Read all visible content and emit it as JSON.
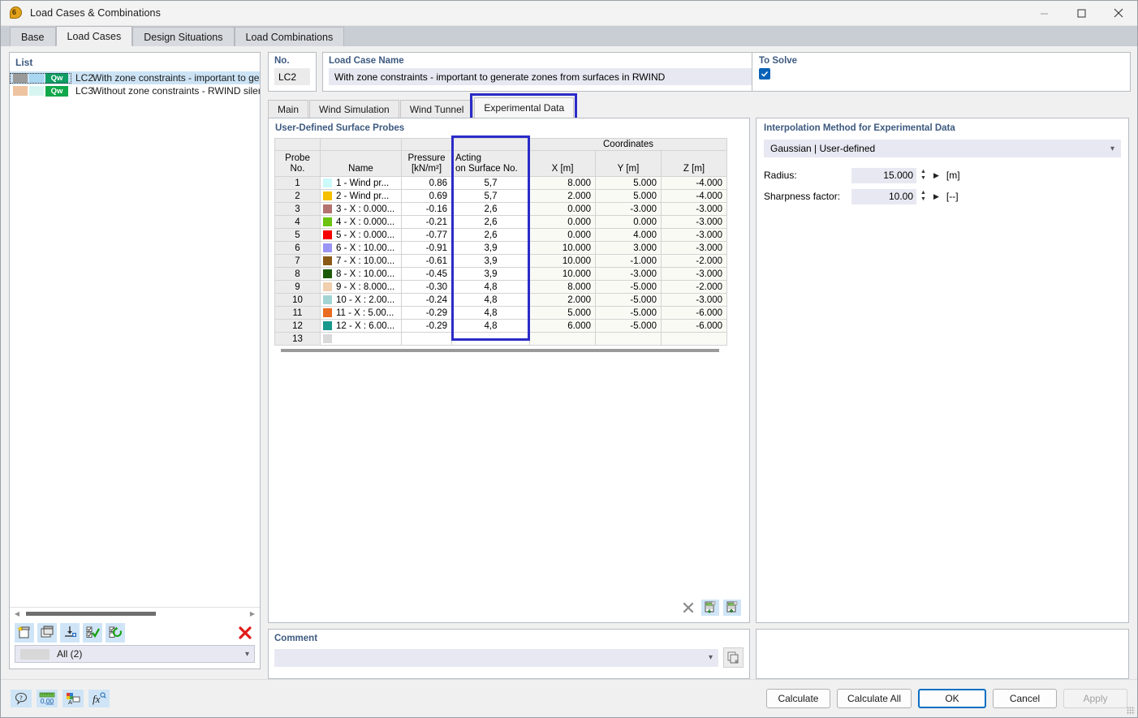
{
  "window": {
    "title": "Load Cases & Combinations",
    "icon": "load-case-icon",
    "minimize": "—",
    "maximize": "□",
    "close": "✕"
  },
  "top_tabs": [
    {
      "label": "Base",
      "active": false
    },
    {
      "label": "Load Cases",
      "active": true
    },
    {
      "label": "Design Situations",
      "active": false
    },
    {
      "label": "Load Combinations",
      "active": false
    }
  ],
  "list_panel": {
    "title": "List",
    "items": [
      {
        "no": "LC2",
        "name": "With zone constraints - important to generate zones from surfaces in RWIND",
        "badge": "Qw",
        "badge_color": "#0f9e63",
        "swatch1": "#9a9a9a",
        "swatch2": "#a9d6f0",
        "selected": true
      },
      {
        "no": "LC3",
        "name": "Without zone constraints - RWIND silent",
        "badge": "Qw",
        "badge_color": "#11a84a",
        "swatch1": "#edc3a0",
        "swatch2": "#d7f5f0",
        "selected": false
      }
    ],
    "toolbar": [
      {
        "name": "new-load-case-button",
        "icon": "new-window-icon"
      },
      {
        "name": "copy-load-case-button",
        "icon": "copy-window-icon"
      },
      {
        "name": "import-load-case-button",
        "icon": "import-icon"
      },
      {
        "name": "select-all-button",
        "icon": "checklist-check-icon"
      },
      {
        "name": "refresh-selection-button",
        "icon": "checklist-refresh-icon"
      },
      {
        "name": "delete-load-case-button",
        "icon": "red-x-icon"
      }
    ],
    "filter": {
      "label": "All (2)",
      "swatch": "#d8d8d8"
    }
  },
  "fields": {
    "no_label": "No.",
    "no_value": "LC2",
    "name_label": "Load Case Name",
    "name_value": "With zone constraints - important to generate zones from surfaces in RWIND"
  },
  "to_solve": {
    "label": "To Solve",
    "checked": true,
    "accent": "#0a62b8"
  },
  "inner_tabs": [
    {
      "label": "Main",
      "active": false
    },
    {
      "label": "Wind Simulation",
      "active": false
    },
    {
      "label": "Wind Tunnel",
      "active": false
    },
    {
      "label": "Experimental Data",
      "active": true,
      "highlighted": true
    }
  ],
  "probes": {
    "title": "User-Defined Surface Probes",
    "columns": {
      "probe_no": "Probe\nNo.",
      "probe_no_l1": "Probe",
      "probe_no_l2": "No.",
      "name": "Name",
      "pressure_l1": "Pressure",
      "pressure_l2": "[kN/m²]",
      "acting_l1": "Acting",
      "acting_l2": "on Surface No.",
      "coordinates": "Coordinates",
      "x": "X [m]",
      "y": "Y [m]",
      "z": "Z [m]"
    },
    "highlight_color": "#2b2bc8",
    "rows": [
      {
        "no": "1",
        "color": "#ccfafa",
        "name": "1 - Wind pr...",
        "pressure": "0.86",
        "surface": "5,7",
        "x": "8.000",
        "y": "5.000",
        "z": "-4.000"
      },
      {
        "no": "2",
        "color": "#f5c000",
        "name": "2 - Wind pr...",
        "pressure": "0.69",
        "surface": "5,7",
        "x": "2.000",
        "y": "5.000",
        "z": "-4.000"
      },
      {
        "no": "3",
        "color": "#b5736f",
        "name": "3 - X : 0.000...",
        "pressure": "-0.16",
        "surface": "2,6",
        "x": "0.000",
        "y": "-3.000",
        "z": "-3.000"
      },
      {
        "no": "4",
        "color": "#6cc310",
        "name": "4 - X : 0.000...",
        "pressure": "-0.21",
        "surface": "2,6",
        "x": "0.000",
        "y": "0.000",
        "z": "-3.000"
      },
      {
        "no": "5",
        "color": "#f60000",
        "name": "5 - X : 0.000...",
        "pressure": "-0.77",
        "surface": "2,6",
        "x": "0.000",
        "y": "4.000",
        "z": "-3.000"
      },
      {
        "no": "6",
        "color": "#9a95f5",
        "name": "6 - X : 10.00...",
        "pressure": "-0.91",
        "surface": "3,9",
        "x": "10.000",
        "y": "3.000",
        "z": "-3.000"
      },
      {
        "no": "7",
        "color": "#8a5a17",
        "name": "7 - X : 10.00...",
        "pressure": "-0.61",
        "surface": "3,9",
        "x": "10.000",
        "y": "-1.000",
        "z": "-2.000"
      },
      {
        "no": "8",
        "color": "#1d5a08",
        "name": "8 - X : 10.00...",
        "pressure": "-0.45",
        "surface": "3,9",
        "x": "10.000",
        "y": "-3.000",
        "z": "-3.000"
      },
      {
        "no": "9",
        "color": "#f0cfae",
        "name": "9 - X : 8.000...",
        "pressure": "-0.30",
        "surface": "4,8",
        "x": "8.000",
        "y": "-5.000",
        "z": "-2.000"
      },
      {
        "no": "10",
        "color": "#a3d4d4",
        "name": "10 - X : 2.00...",
        "pressure": "-0.24",
        "surface": "4,8",
        "x": "2.000",
        "y": "-5.000",
        "z": "-3.000"
      },
      {
        "no": "11",
        "color": "#ea6b22",
        "name": "11 - X : 5.00...",
        "pressure": "-0.29",
        "surface": "4,8",
        "x": "5.000",
        "y": "-5.000",
        "z": "-6.000"
      },
      {
        "no": "12",
        "color": "#17998c",
        "name": "12 - X : 6.00...",
        "pressure": "-0.29",
        "surface": "4,8",
        "x": "6.000",
        "y": "-5.000",
        "z": "-6.000"
      },
      {
        "no": "13",
        "color": "#d9d9d9",
        "name": "",
        "pressure": "",
        "surface": "",
        "x": "",
        "y": "",
        "z": ""
      }
    ],
    "tools": [
      {
        "name": "clear-table-button",
        "icon": "x-icon"
      },
      {
        "name": "import-table-button",
        "icon": "table-import-icon"
      },
      {
        "name": "export-table-button",
        "icon": "table-export-icon"
      }
    ]
  },
  "interpolation": {
    "title": "Interpolation Method for Experimental Data",
    "method": "Gaussian | User-defined",
    "radius_label": "Radius:",
    "radius_value": "15.000",
    "radius_unit": "[m]",
    "sharpness_label": "Sharpness factor:",
    "sharpness_value": "10.00",
    "sharpness_unit": "[--]"
  },
  "comment": {
    "title": "Comment",
    "value": "",
    "copy_icon": "copy-icon"
  },
  "footer": {
    "tools": [
      {
        "name": "help-button",
        "icon": "question-bubble-icon"
      },
      {
        "name": "units-button",
        "icon": "units-icon",
        "text": "0,00"
      },
      {
        "name": "display-properties-button",
        "icon": "color-palette-icon"
      },
      {
        "name": "formula-button",
        "icon": "fx-icon"
      }
    ],
    "buttons": [
      {
        "label": "Calculate",
        "name": "calculate-button",
        "style": "normal"
      },
      {
        "label": "Calculate All",
        "name": "calculate-all-button",
        "style": "normal"
      },
      {
        "label": "OK",
        "name": "ok-button",
        "style": "default"
      },
      {
        "label": "Cancel",
        "name": "cancel-button",
        "style": "normal"
      },
      {
        "label": "Apply",
        "name": "apply-button",
        "style": "disabled"
      }
    ]
  }
}
